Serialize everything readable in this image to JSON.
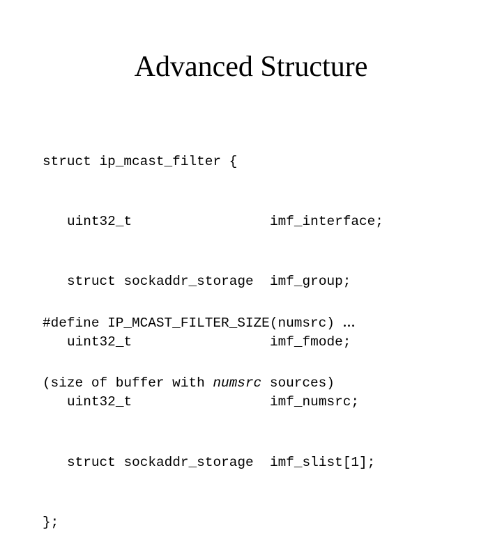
{
  "slide": {
    "title": "Advanced Structure",
    "struct": {
      "open": "struct ip_mcast_filter {",
      "fields": [
        {
          "type": "uint32_t",
          "name": "imf_interface;"
        },
        {
          "type": "struct sockaddr_storage",
          "name": "imf_group;"
        },
        {
          "type": "uint32_t",
          "name": "imf_fmode;"
        },
        {
          "type": "uint32_t",
          "name": "imf_numsrc;"
        },
        {
          "type": "struct sockaddr_storage",
          "name": "imf_slist[1];"
        }
      ],
      "close": "};"
    },
    "define": {
      "macro": "#define IP_MCAST_FILTER_SIZE(numsrc) ",
      "ellipsis": "...",
      "desc_prefix": "(size of buffer with ",
      "desc_italic": "numsrc",
      "desc_suffix": " sources)"
    }
  }
}
